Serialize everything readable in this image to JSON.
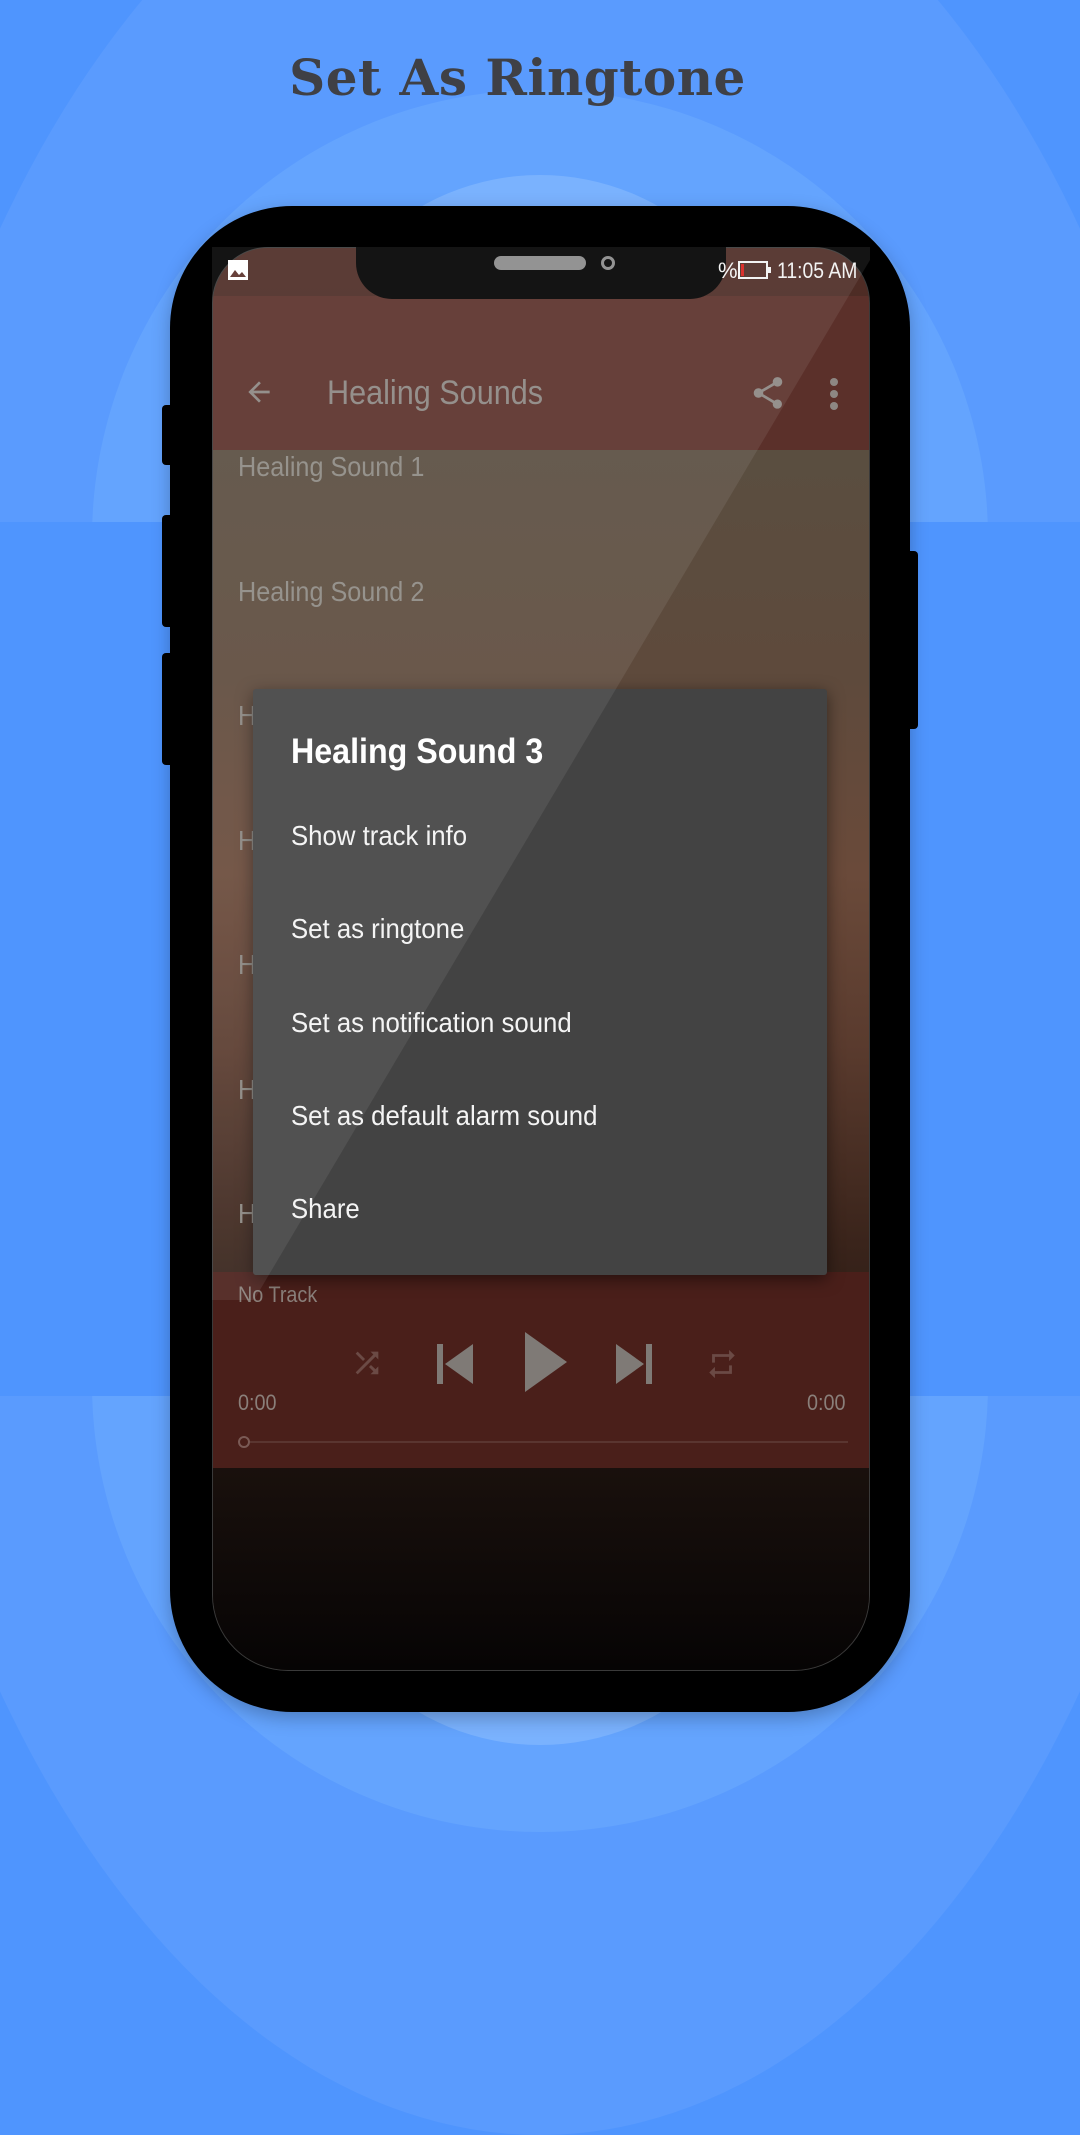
{
  "headline": "Set As Ringtone",
  "status_bar": {
    "battery_fragment": "%",
    "time": "11:05 AM",
    "left_icon": "image-notification-icon",
    "battery_icon": "battery-low-icon"
  },
  "app_bar": {
    "title": "Healing Sounds",
    "back_icon": "arrow-back-icon",
    "share_icon": "share-icon",
    "more_icon": "more-vert-icon"
  },
  "track_list": [
    {
      "label": "Healing Sound 1"
    },
    {
      "label": "Healing Sound 2"
    },
    {
      "label": "H"
    },
    {
      "label": "H"
    },
    {
      "label": "H"
    },
    {
      "label": "H"
    },
    {
      "label": "H"
    }
  ],
  "dialog": {
    "title": "Healing Sound 3",
    "items": [
      {
        "label": "Show track info"
      },
      {
        "label": "Set as ringtone"
      },
      {
        "label": "Set as notification sound"
      },
      {
        "label": "Set as default alarm sound"
      },
      {
        "label": "Share"
      }
    ]
  },
  "player": {
    "now_playing": "No Track",
    "elapsed": "0:00",
    "duration": "0:00",
    "progress": 0,
    "controls": [
      "shuffle-icon",
      "skip-previous-icon",
      "play-icon",
      "skip-next-icon",
      "repeat-icon"
    ]
  },
  "colors": {
    "background": "#4F95FE",
    "headline": "#3F4045",
    "app_bar": "#5B302A",
    "dialog": "#434343",
    "player": "#4A1F1A"
  }
}
